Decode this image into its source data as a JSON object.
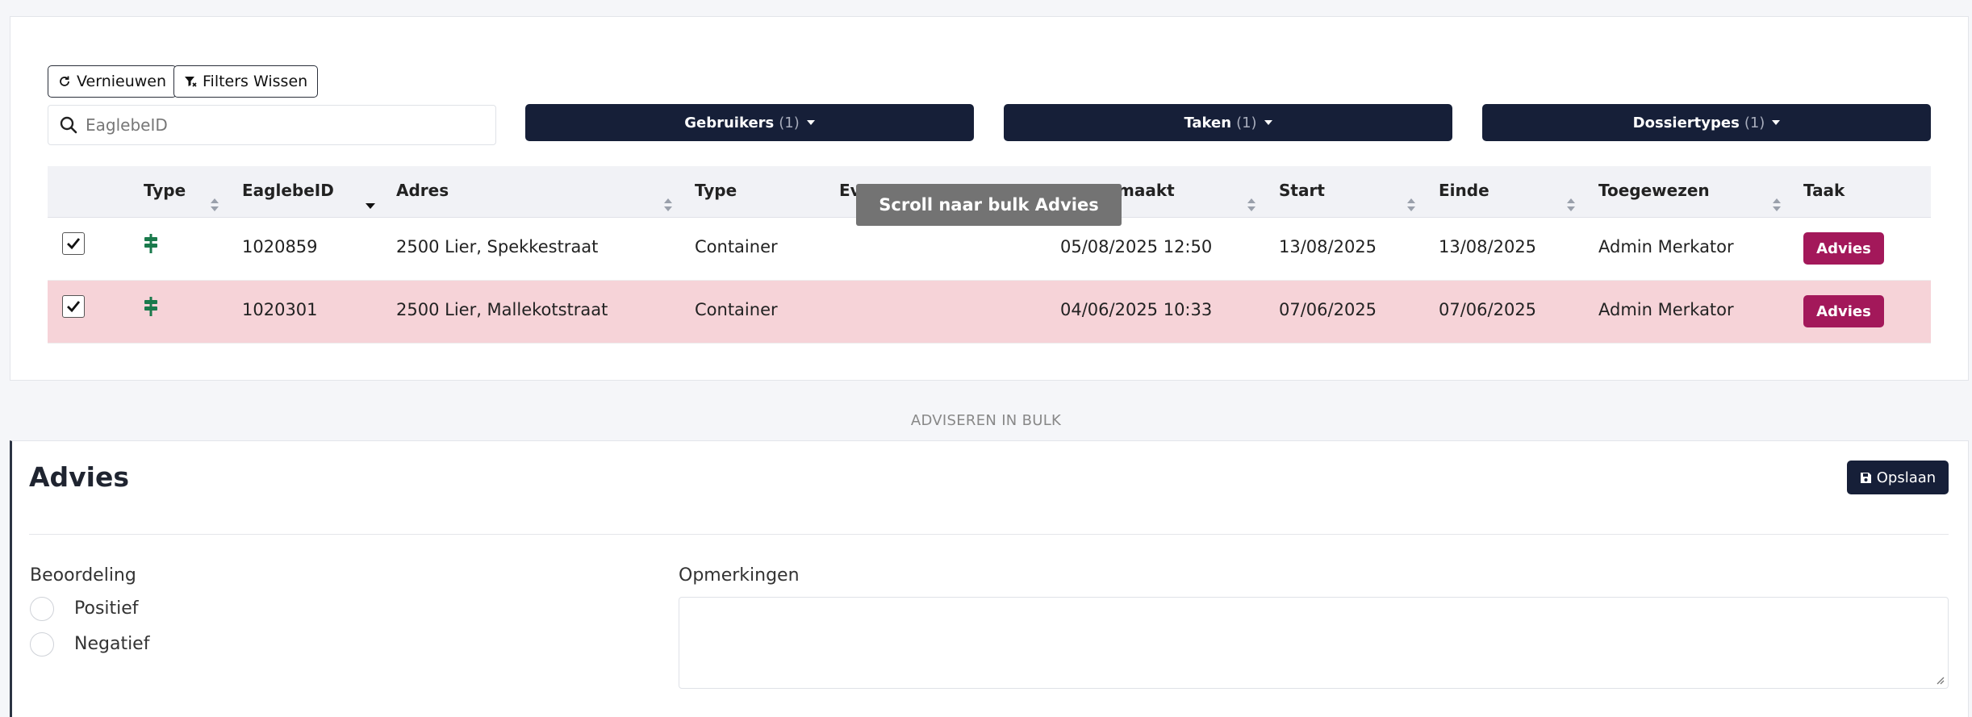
{
  "toolbar": {
    "refresh_label": "Vernieuwen",
    "clear_filters_label": "Filters Wissen"
  },
  "search": {
    "placeholder": "EaglebeID",
    "value": ""
  },
  "filters": [
    {
      "label": "Gebruikers",
      "count": "(1)"
    },
    {
      "label": "Taken",
      "count": "(1)"
    },
    {
      "label": "Dossiertypes",
      "count": "(1)"
    }
  ],
  "table": {
    "headers": {
      "type": "Type",
      "eaglebeid": "EaglebeID",
      "adres": "Adres",
      "type2": "Type",
      "ev": "Ev",
      "gemaakt": "maakt",
      "start": "Start",
      "einde": "Einde",
      "toegewezen": "Toegewezen",
      "taak": "Taak"
    },
    "rows": [
      {
        "checked": true,
        "eaglebeid": "1020859",
        "adres": "2500 Lier, Spekkestraat",
        "type": "Container",
        "gemaakt": "05/08/2025 12:50",
        "start": "13/08/2025",
        "einde": "13/08/2025",
        "toegewezen": "Admin Merkator",
        "taak": "Advies"
      },
      {
        "checked": true,
        "eaglebeid": "1020301",
        "adres": "2500 Lier, Mallekotstraat",
        "type": "Container",
        "gemaakt": "04/06/2025 10:33",
        "start": "07/06/2025",
        "einde": "07/06/2025",
        "toegewezen": "Admin Merkator",
        "taak": "Advies"
      }
    ],
    "type_icon": "signpost-icon"
  },
  "tooltip": "Scroll naar bulk Advies",
  "bulk": {
    "section_label": "ADVISEREN IN BULK",
    "title": "Advies",
    "save_label": "Opslaan",
    "beoordeling_label": "Beoordeling",
    "options": [
      "Positief",
      "Negatief"
    ],
    "opmerkingen_label": "Opmerkingen",
    "opmerkingen_value": ""
  },
  "colors": {
    "navy": "#161f38",
    "advies": "#a3185a",
    "highlight_row": "#f6d3d8",
    "icon_green": "#1a7a4c"
  }
}
